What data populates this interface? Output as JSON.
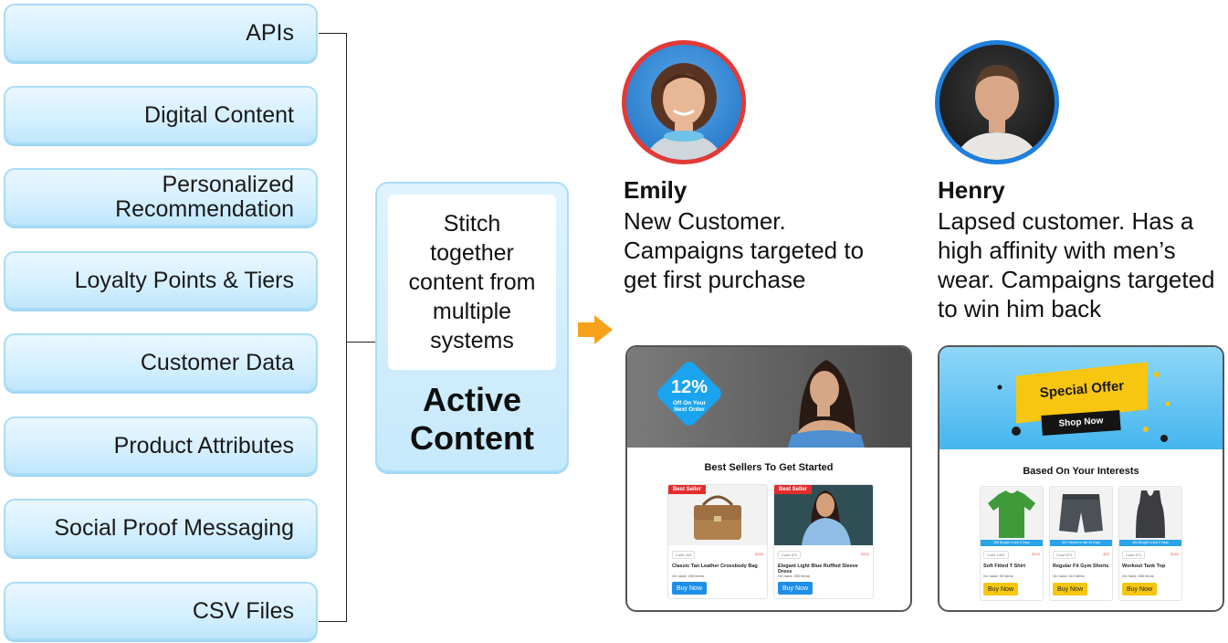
{
  "sources": [
    "APIs",
    "Digital Content",
    "Personalized Recommendation",
    "Loyalty Points & Tiers",
    "Customer Data",
    "Product Attributes",
    "Social Proof Messaging",
    "CSV Files"
  ],
  "hub": {
    "description": "Stitch together content from multiple systems",
    "title": "Active Content"
  },
  "personas": [
    {
      "name": "Emily",
      "description": "New Customer. Campaigns targeted to get first purchase",
      "ring_color": "#e23a36"
    },
    {
      "name": "Henry",
      "description": "Lapsed customer. Has a high affinity with men’s wear. Campaigns targeted to win him back",
      "ring_color": "#1f7fdc"
    }
  ],
  "emily_card": {
    "discount_value": "12%",
    "discount_text": "Off On Your Next Order",
    "section_title": "Best Sellers To Get Started",
    "products": [
      {
        "badge": "Best Seller",
        "code": "Code 449",
        "price": "$165",
        "name": "Classic Tan Leather Crossbody Bag",
        "on_hand": "On hand: 200 items",
        "button": "Buy Now"
      },
      {
        "badge": "Best Seller",
        "code": "Code 872",
        "price": "$150",
        "name": "Elegant Light Blue Ruffled Sleeve Dress",
        "on_hand": "On hand: 250 items",
        "button": "Buy Now"
      }
    ]
  },
  "henry_card": {
    "offer_title": "Special Offer",
    "offer_button": "Shop Now",
    "section_title": "Based On Your Interests",
    "products": [
      {
        "strip": "285 Bought in last 3 Days",
        "code": "Code 1491",
        "price": "$120",
        "name": "Soft Fitted T Shirt",
        "on_hand": "On hand: 90 items",
        "button": "Buy Now"
      },
      {
        "strip": "324 Viewed in last 30 Days",
        "code": "Code 872",
        "price": "$15",
        "name": "Regular Fit Gym Shorts",
        "on_hand": "On hand: 110 items",
        "button": "Buy Now"
      },
      {
        "strip": "484 Bought in last 2 Days",
        "code": "Code 971",
        "price": "$180",
        "name": "Workout Tank Top",
        "on_hand": "On hand: 280 items",
        "button": "Buy Now"
      }
    ]
  },
  "colors": {
    "source_fill": "#d3efff",
    "arrow": "#f7a21b",
    "blue_button": "#1e8fe8",
    "yellow_button": "#f6c611",
    "sale_badge": "#e32d2d"
  }
}
